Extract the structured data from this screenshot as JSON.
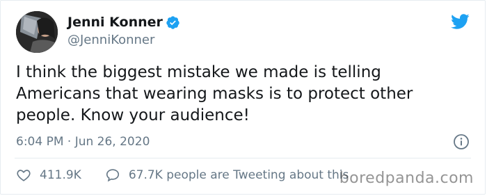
{
  "tweet": {
    "author": {
      "display_name": "Jenni Konner",
      "handle": "@JenniKonner",
      "verified": true
    },
    "text": "I think the biggest mistake we made is telling Americans that wearing masks is to protect other people. Know your audience!",
    "timestamp": "6:04 PM · Jun 26, 2020",
    "likes": "411.9K",
    "conversation": "67.7K people are Tweeting about this"
  },
  "watermark": "boredpanda.com",
  "colors": {
    "twitter_blue": "#1da1f2",
    "secondary_text": "#657786",
    "primary_text": "#14171a"
  },
  "icons": {
    "brand": "twitter-bird-icon",
    "verified": "verified-badge-icon",
    "info": "info-icon",
    "like": "heart-icon",
    "reply": "speech-bubble-icon"
  }
}
